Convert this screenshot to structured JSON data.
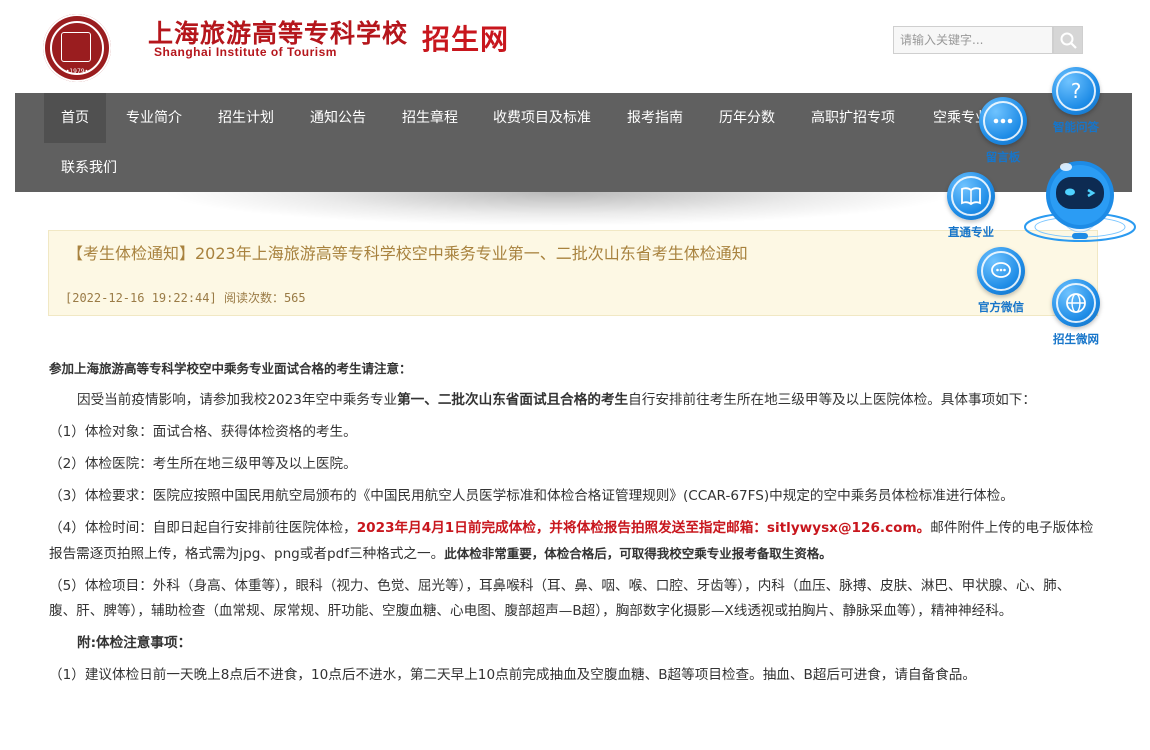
{
  "header": {
    "school_name_cn": "上海旅游高等专科学校",
    "school_name_en": "Shanghai Institute of Tourism",
    "site_name": "招生网",
    "logo_year": "•1979•",
    "search_placeholder": "请输入关键字..."
  },
  "nav": {
    "items": [
      {
        "label": "首页",
        "active": true
      },
      {
        "label": "专业简介"
      },
      {
        "label": "招生计划"
      },
      {
        "label": "通知公告"
      },
      {
        "label": "招生章程"
      },
      {
        "label": "收费项目及标准"
      },
      {
        "label": "报考指南"
      },
      {
        "label": "历年分数"
      },
      {
        "label": "高职扩招专项"
      },
      {
        "label": "空乘专业"
      },
      {
        "label": "联系我们"
      }
    ]
  },
  "article": {
    "title": "【考生体检通知】2023年上海旅游高等专科学校空中乘务专业第一、二批次山东省考生体检通知",
    "meta": "[2022-12-16 19:22:44]  阅读次数：565"
  },
  "content": {
    "intro": "参加上海旅游高等专科学校空中乘务专业面试合格的考生请注意：",
    "p1_a": "因受当前疫情影响，请参加我校2023年空中乘务专业",
    "p1_b": "第一、二批次山东省面试且合格的考生",
    "p1_c": "自行安排前往考生所在地三级甲等及以上医院体检。具体事项如下：",
    "item1": "（1）体检对象：面试合格、获得体检资格的考生。",
    "item2": "（2）体检医院：考生所在地三级甲等及以上医院。",
    "item3": "（3）体检要求：医院应按照中国民用航空局颁布的《中国民用航空人员医学标准和体检合格证管理规则》(CCAR-67FS)中规定的空中乘务员体检标准进行体检。",
    "item4_a": "（4）体检时间：自即日起自行安排前往医院体检，",
    "item4_red": "2023年月4月1日前完成体检，并将体检报告拍照发送至指定邮箱：sitlywysx@126.com。",
    "item4_b": "邮件附件上传的电子版体检报告需逐页拍照上传，格式需为jpg、png或者pdf三种格式之一。",
    "item4_bold": "此体检非常重要，体检合格后，可取得我校空乘专业报考备取生资格。",
    "item5": "（5）体检项目：外科（身高、体重等），眼科（视力、色觉、屈光等），耳鼻喉科（耳、鼻、咽、喉、口腔、牙齿等），内科（血压、脉搏、皮肤、淋巴、甲状腺、心、肺、腹、肝、脾等），辅助检查（血常规、尿常规、肝功能、空腹血糖、心电图、腹部超声—B超），胸部数字化摄影—X线透视或拍胸片、静脉采血等），精神神经科。",
    "annex_title": "附:体检注意事项：",
    "annex1": "（1）建议体检日前一天晚上8点后不进食，10点后不进水，第二天早上10点前完成抽血及空腹血糖、B超等项目检查。抽血、B超后可进食，请自备食品。"
  },
  "widgets": {
    "faq": "智能问答",
    "message": "留言板",
    "direct": "直通专业",
    "wechat": "官方微信",
    "weibo": "招生微网"
  }
}
